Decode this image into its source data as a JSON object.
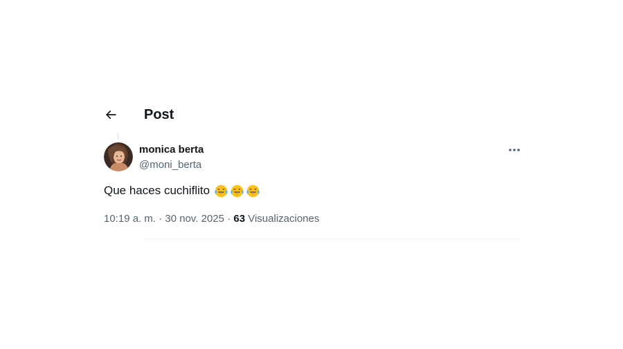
{
  "header": {
    "back_icon": "arrow-left-icon",
    "title": "Post"
  },
  "tweet": {
    "display_name": "monica berta",
    "handle": "@moni_berta",
    "text": "Que haces cuchiflito",
    "emojis": [
      "face-with-tears-of-joy",
      "face-with-tears-of-joy",
      "face-with-tears-of-joy"
    ],
    "more_icon": "more-horizontal-icon",
    "time": "10:19 a. m.",
    "separator": "·",
    "date": "30 nov. 2025",
    "views_count": "63",
    "views_label": "Visualizaciones"
  },
  "colors": {
    "text_primary": "#0f1419",
    "text_secondary": "#536471",
    "divider": "#eff3f4",
    "emoji_face": "#fcc21b"
  }
}
